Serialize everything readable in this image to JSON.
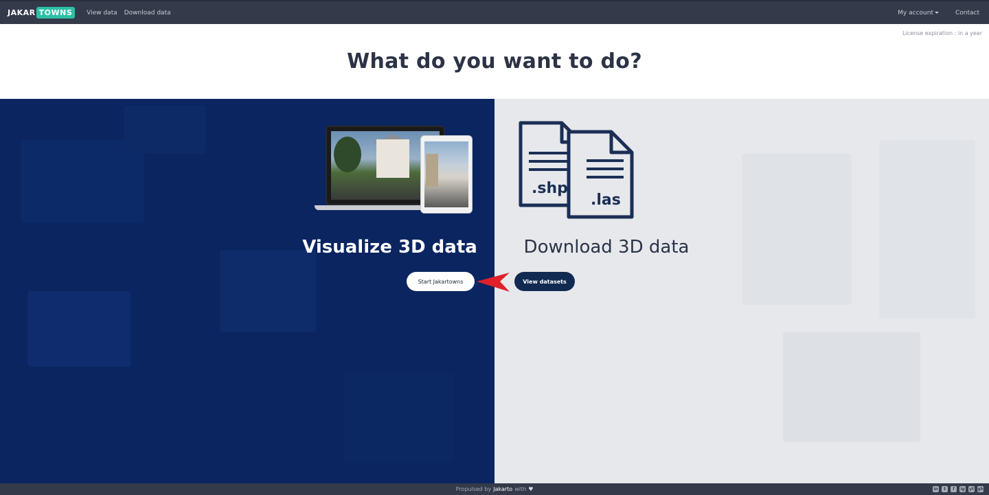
{
  "navbar": {
    "logo_part1": "JAKAR",
    "logo_part2": "TOWNS",
    "links": [
      "View data",
      "Download data"
    ],
    "right_links": {
      "account": "My account",
      "contact": "Contact"
    }
  },
  "license": "License expiration : in a year",
  "heading": "What do you want to do?",
  "visualize": {
    "title": "Visualize 3D data",
    "button": "Start Jakartowns"
  },
  "download": {
    "title": "Download 3D data",
    "button": "View datasets",
    "file1_ext": ".shp",
    "file2_ext": ".las"
  },
  "footer": {
    "text": "Propulsed by",
    "brand": "Jakarto",
    "suffix": "with",
    "socials": [
      "in",
      "t",
      "f",
      "ig",
      "yt",
      "gh"
    ]
  },
  "colors": {
    "navbar": "#343a4a",
    "left_panel": "#0a2560",
    "right_panel": "#e6e8ec",
    "accent": "#2ec0a7",
    "arrow": "#e0202a"
  }
}
